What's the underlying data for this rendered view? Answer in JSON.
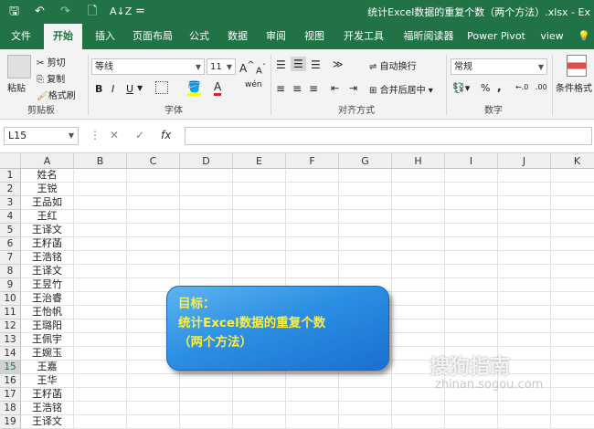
{
  "quick_access": {
    "save": "🖫",
    "undo": "↶",
    "redo": "↷",
    "preview": "🗋",
    "sort": "A↓Z",
    "more": "="
  },
  "window_title": "统计Excel数据的重复个数（两个方法）.xlsx  -  Ex",
  "tabs": [
    "文件",
    "开始",
    "插入",
    "页面布局",
    "公式",
    "数据",
    "审阅",
    "视图",
    "开发工具",
    "福昕阅读器",
    "Power Pivot",
    "view"
  ],
  "active_tab": "开始",
  "ribbon": {
    "clipboard": {
      "paste": "粘贴",
      "cut": "剪切",
      "copy": "复制",
      "format_painter": "格式刷",
      "label": "剪贴板"
    },
    "font": {
      "name": "等线",
      "size": "11",
      "grow": "A",
      "shrink": "A",
      "bold": "B",
      "italic": "I",
      "underline": "U",
      "fill_color": "A",
      "font_color": "A",
      "wen": "wén",
      "label": "字体"
    },
    "alignment": {
      "wrap": "自动换行",
      "merge": "合并后居中",
      "label": "对齐方式"
    },
    "number": {
      "format": "常规",
      "percent": "%",
      "comma": ",",
      "inc": "←.0",
      "dec": ".00",
      "label": "数字"
    },
    "styles": {
      "conditional": "条件格式"
    }
  },
  "formula_bar": {
    "name_box": "L15",
    "cancel": "✕",
    "enter": "✓",
    "fx": "fx",
    "value": ""
  },
  "columns": [
    "A",
    "B",
    "C",
    "D",
    "E",
    "F",
    "G",
    "H",
    "I",
    "J",
    "K"
  ],
  "selected_column": "L",
  "rows": [
    {
      "n": "1",
      "a": "姓名"
    },
    {
      "n": "2",
      "a": "王锐"
    },
    {
      "n": "3",
      "a": "王品如"
    },
    {
      "n": "4",
      "a": "王红"
    },
    {
      "n": "5",
      "a": "王译文"
    },
    {
      "n": "6",
      "a": "王籽菡"
    },
    {
      "n": "7",
      "a": "王浩铭"
    },
    {
      "n": "8",
      "a": "王译文"
    },
    {
      "n": "9",
      "a": "王昱竹"
    },
    {
      "n": "10",
      "a": "王治睿"
    },
    {
      "n": "11",
      "a": "王怡帆"
    },
    {
      "n": "12",
      "a": "王璐阳"
    },
    {
      "n": "13",
      "a": "王佩宇"
    },
    {
      "n": "14",
      "a": "王婉玉"
    },
    {
      "n": "15",
      "a": "王嘉"
    },
    {
      "n": "16",
      "a": "王华"
    },
    {
      "n": "17",
      "a": "王籽菡"
    },
    {
      "n": "18",
      "a": "王浩铭"
    },
    {
      "n": "19",
      "a": "王译文"
    }
  ],
  "selected_row": "15",
  "callout": {
    "line1": "目标：",
    "line2": "统计Excel数据的重复个数",
    "line3": "（两个方法）"
  },
  "watermark": {
    "line1": "搜狗指南",
    "line2": "zhinan.sogou.com"
  },
  "colors": {
    "excel_green": "#217346",
    "callout_text": "#ffef3a",
    "callout_blue": "#2b8fe3"
  }
}
